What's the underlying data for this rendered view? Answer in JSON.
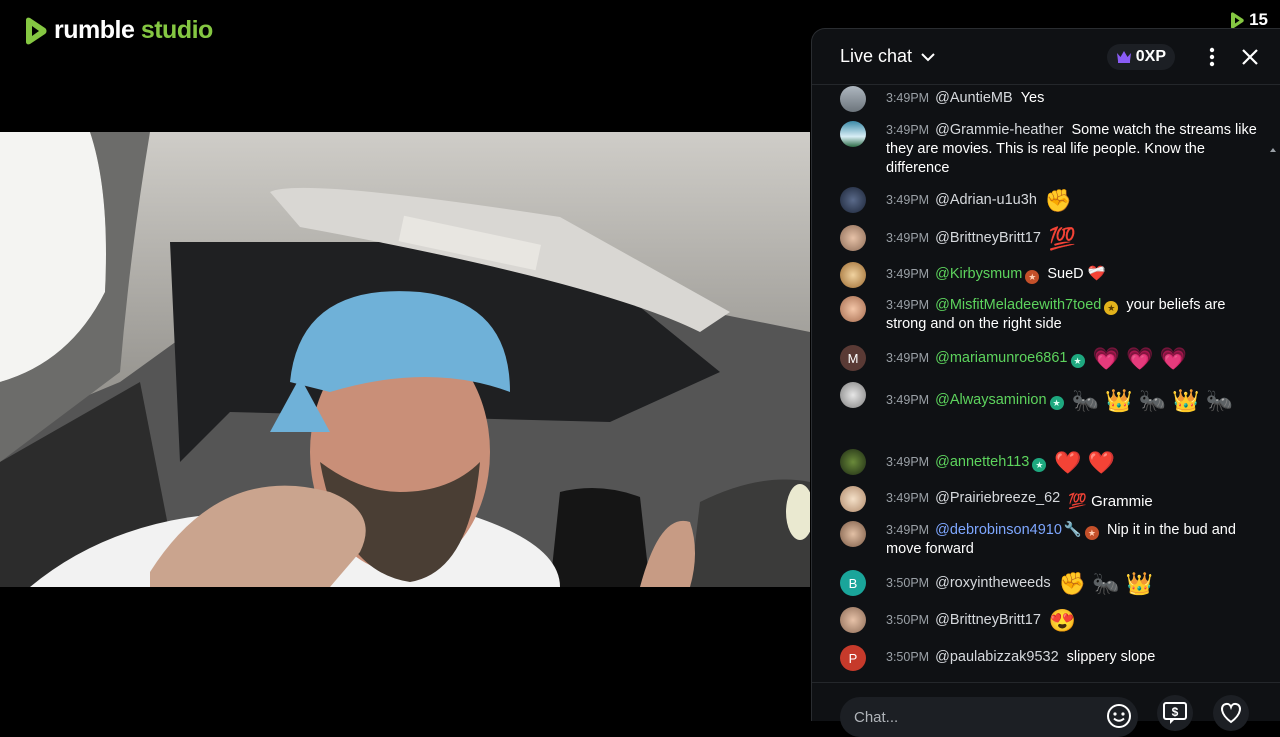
{
  "brand": {
    "word1": "rumble",
    "word2": "studio"
  },
  "viewer_count": "15",
  "chat": {
    "title": "Live chat",
    "xp": "0XP",
    "input_placeholder": "Chat...",
    "messages": [
      {
        "time": "3:49PM",
        "user": "@AuntieMB",
        "text": "Yes"
      },
      {
        "time": "3:49PM",
        "user": "@Grammie-heather",
        "text": "Some watch the streams like they are movies. This is real life people. Know the difference"
      },
      {
        "time": "3:49PM",
        "user": "@Adrian-u1u3h",
        "text": "✊"
      },
      {
        "time": "3:49PM",
        "user": "@BrittneyBritt17",
        "text": "💯"
      },
      {
        "time": "3:49PM",
        "user": "@Kirbysmum",
        "text": "SueD ❤️‍🩹"
      },
      {
        "time": "3:49PM",
        "user": "@MisfitMeladeewith7toed",
        "text": "your beliefs are strong and on the right side"
      },
      {
        "time": "3:49PM",
        "user": "@mariamunroe6861",
        "text": "💗 💗 💗",
        "avatar_letter": "M"
      },
      {
        "time": "3:49PM",
        "user": "@Alwaysaminion",
        "text": "🐜 👑 🐜 👑 🐜"
      },
      {
        "time": "3:49PM",
        "user": "@annetteh113",
        "text": "❤️ ❤️"
      },
      {
        "time": "3:49PM",
        "user": "@Prairiebreeze_62",
        "text": "💯 Grammie"
      },
      {
        "time": "3:49PM",
        "user": "@debrobinson4910",
        "text": "Nip it in the bud and move forward"
      },
      {
        "time": "3:50PM",
        "user": "@roxyintheweeds",
        "text": "✊ 🐜 👑",
        "avatar_letter": "B"
      },
      {
        "time": "3:50PM",
        "user": "@BrittneyBritt17",
        "text": "😍"
      },
      {
        "time": "3:50PM",
        "user": "@paulabizzak9532",
        "text": "slippery slope",
        "avatar_letter": "P"
      }
    ]
  },
  "colors": {
    "brand_green": "#85c742",
    "chat_bg": "#0f1114",
    "subscriber_green": "#5dd35d",
    "mod_blue": "#7ea7ff"
  }
}
